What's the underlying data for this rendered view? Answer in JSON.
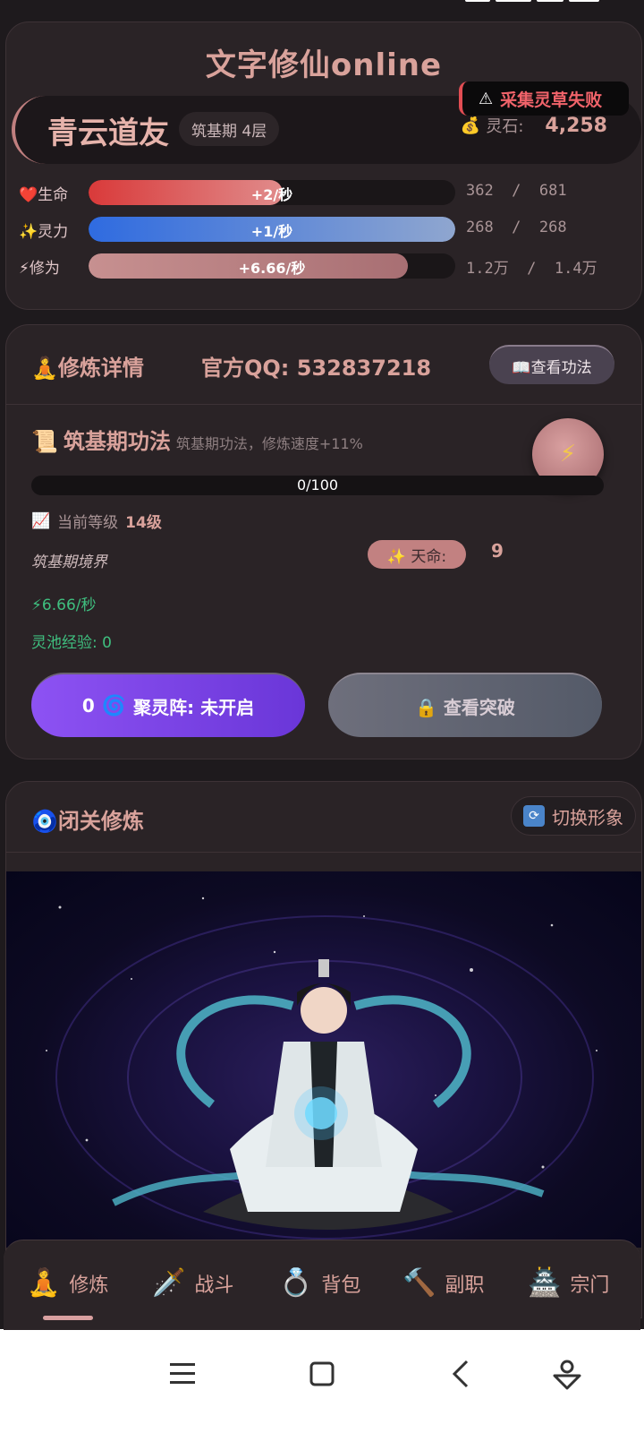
{
  "app": {
    "title": "文字修仙online"
  },
  "toast": {
    "icon": "warning-icon",
    "text": "采集灵草失败"
  },
  "player": {
    "name": "青云道友",
    "realm_badge": "筑基期 4层",
    "stone_label": "灵石:",
    "stone_value": "4,258"
  },
  "stats": [
    {
      "label": "❤️生命",
      "rate": "+2/秒",
      "value": "362  /  681",
      "fill": 0.53,
      "color_start": "#d93a3a",
      "color_end": "#e08b8b"
    },
    {
      "label": "✨灵力",
      "rate": "+1/秒",
      "value": "268  /  268",
      "fill": 1.0,
      "color_start": "#2f6be0",
      "color_end": "#8fa6cf"
    },
    {
      "label": "⚡修为",
      "rate": "+6.66/秒",
      "value": "1.2万  /  1.4万",
      "fill": 0.87,
      "color_start": "#c79090",
      "color_end": "#a86f73"
    }
  ],
  "cultivation": {
    "title": "🧘修炼详情",
    "qq": "官方QQ: 532837218",
    "view_skill_label": "📖查看功法",
    "skill_icon": "📜",
    "skill_name": "筑基期功法",
    "skill_desc": "筑基期功法，修炼速度+11%",
    "exp_text": "0/100",
    "level_icon": "📈",
    "level_label": "当前等级",
    "level_value": "14级",
    "realm_text": "筑基期境界",
    "fate_label": "✨ 天命:",
    "fate_value": "9",
    "rate_text": "⚡6.66/秒",
    "pool_text": "灵池经验: 0",
    "gather_count": "0",
    "gather_label": "聚灵阵: 未开启",
    "breakthrough_label": "🔒 查看突破"
  },
  "retreat": {
    "title": "🧿闭关修炼",
    "switch_label": "切换形象"
  },
  "nav": [
    {
      "icon": "🧘",
      "label": "修炼"
    },
    {
      "icon": "🗡️",
      "label": "战斗"
    },
    {
      "icon": "💍",
      "label": "背包"
    },
    {
      "icon": "🔨",
      "label": "副职"
    },
    {
      "icon": "🏯",
      "label": "宗门"
    }
  ],
  "active_nav": "修炼",
  "colors": {
    "accent": "#d9a29b",
    "green": "#3fbf7f",
    "background": "#1e1a1d",
    "card": "#2a2326"
  }
}
